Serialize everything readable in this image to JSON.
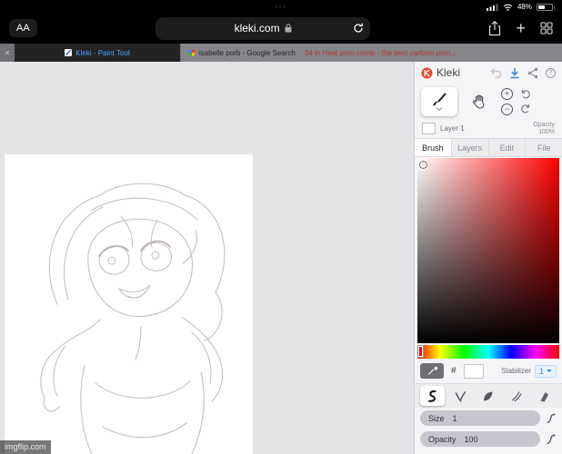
{
  "status": {
    "dots": "···",
    "battery": "48%"
  },
  "browser": {
    "reader": "AA",
    "url": "kleki.com",
    "tab_close": "×",
    "active_tab": "Kleki - Paint Tool",
    "inactive_tab_title": "isabelle porb - Google Search",
    "inactive_tab_subtitle": "34 in Heat porn comic - the best cartoon porn…",
    "plus": "+"
  },
  "panel": {
    "logo": "Kleki",
    "help": "?",
    "zoom_in": "+",
    "zoom_out": "−",
    "layer_name": "Layer 1",
    "layer_opacity_label": "Opacity",
    "layer_opacity_value": "100%",
    "tabs": [
      "Brush",
      "Layers",
      "Edit",
      "File"
    ],
    "hex": "#",
    "stabilizer_label": "Stabilizer",
    "stabilizer_value": "1",
    "size_label": "Size",
    "size_value": "1",
    "opacity_label": "Opacity",
    "opacity_value": "100"
  },
  "watermark": "imgflip.com",
  "colors": {
    "accent_blue": "#4da3ff",
    "download_blue": "#2e86de",
    "tab_warning_red": "#b5372c",
    "picker_hue": "#ff0000",
    "current_color": "#ffffff"
  }
}
